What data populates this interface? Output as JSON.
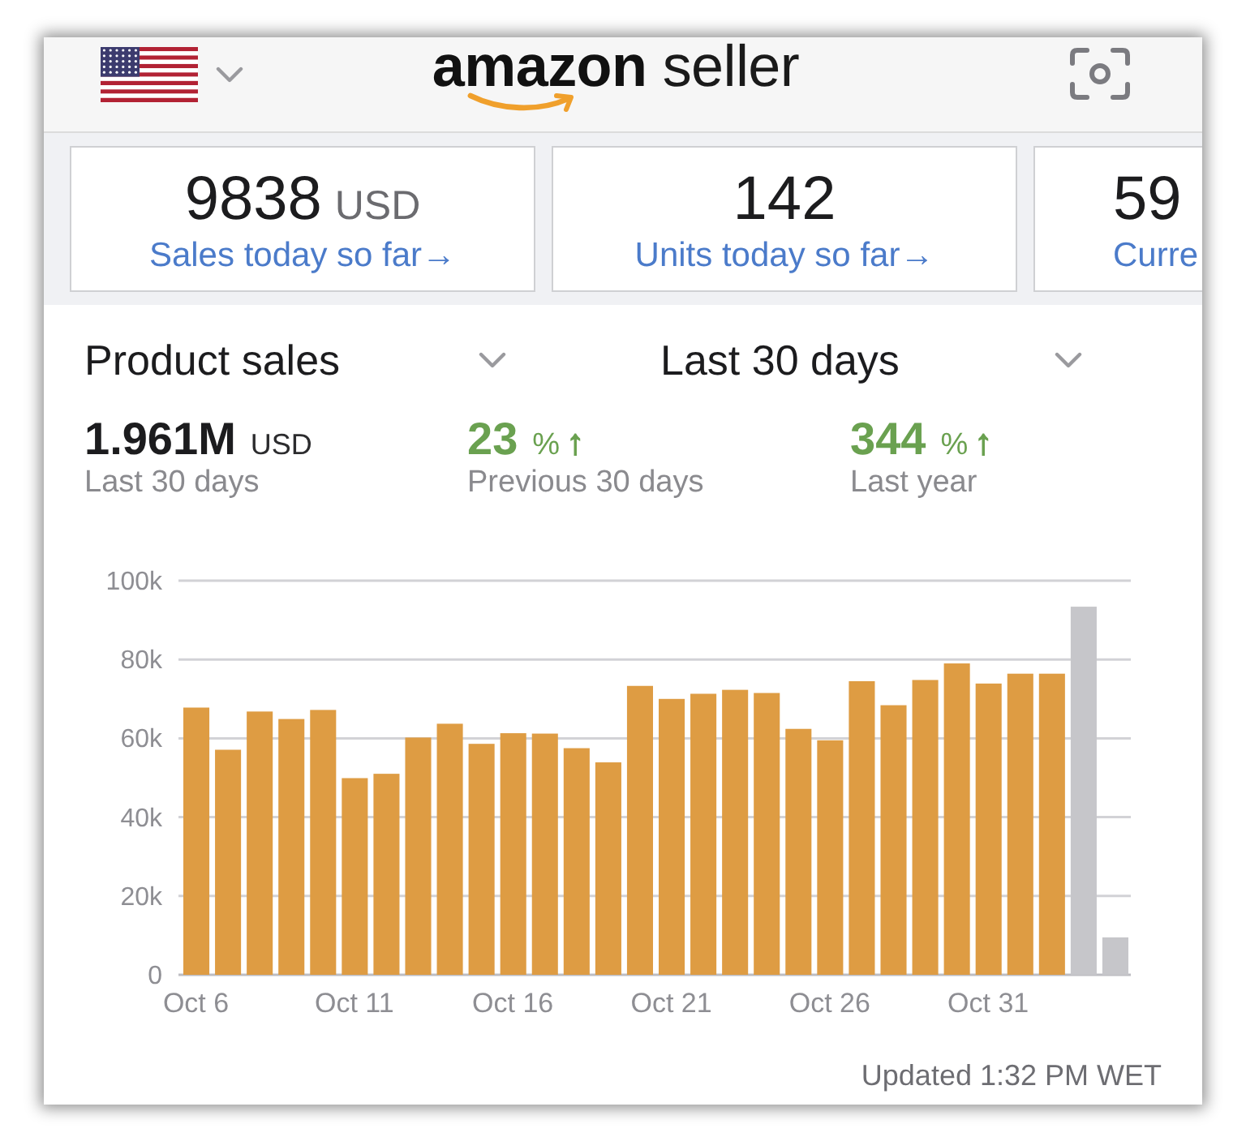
{
  "header": {
    "logo": "**amazon** seller"
  },
  "summary_cards": [
    {
      "value": "9838",
      "unit": "USD",
      "label": "Sales today so far→",
      "clipped": false
    },
    {
      "value": "142",
      "label": "Units today so far→",
      "clipped": false
    },
    {
      "value": "59",
      "label": "Curre",
      "clipped": true
    }
  ],
  "selectors": [
    {
      "label": "Product sales"
    },
    {
      "label": "Last 30 days"
    }
  ],
  "stats": [
    {
      "kind": "total",
      "value": "1.961M",
      "unit": "USD",
      "caption": "Last 30 days"
    },
    {
      "kind": "change",
      "value": "23",
      "unit": "%",
      "arrow": "↑",
      "caption": "Previous 30 days"
    },
    {
      "kind": "change",
      "value": "344",
      "unit": "%",
      "arrow": "↑",
      "caption": "Last year"
    }
  ],
  "chart": {
    "chart_data": {
      "type": "bar",
      "stacked": true,
      "grid": true,
      "categories": [
        "Oct 6",
        null,
        null,
        null,
        null,
        "Oct 11",
        null,
        null,
        null,
        null,
        "Oct 16",
        null,
        null,
        null,
        null,
        "Oct 21",
        null,
        null,
        null,
        null,
        "Oct 26",
        null,
        null,
        null,
        null,
        "Oct 31",
        null,
        null,
        null,
        null
      ],
      "ylim": [
        0,
        100000
      ],
      "yticks": [
        {
          "value": 0,
          "label": "0"
        },
        {
          "value": 20000,
          "label": "20k"
        },
        {
          "value": 40000,
          "label": "40k"
        },
        {
          "value": 60000,
          "label": "60k"
        },
        {
          "value": 80000,
          "label": "80k"
        },
        {
          "value": 100000,
          "label": "100k"
        }
      ],
      "series": [
        {
          "color": "#de9c43",
          "values": [
            67800,
            57100,
            66800,
            64900,
            67200,
            49900,
            51000,
            60200,
            63700,
            58600,
            61300,
            61200,
            57500,
            53900,
            73300,
            70000,
            71300,
            72300,
            71500,
            62400,
            59500,
            74500,
            68400,
            74800,
            79000,
            73900,
            76400,
            76400,
            null,
            null
          ]
        },
        {
          "color": "#c6c6ca",
          "values": [
            null,
            null,
            null,
            null,
            null,
            null,
            null,
            null,
            null,
            null,
            null,
            null,
            null,
            null,
            null,
            null,
            null,
            null,
            null,
            null,
            null,
            null,
            null,
            null,
            null,
            null,
            null,
            null,
            93400,
            9500
          ]
        }
      ]
    }
  },
  "updated": "Updated 1:32 PM WET"
}
